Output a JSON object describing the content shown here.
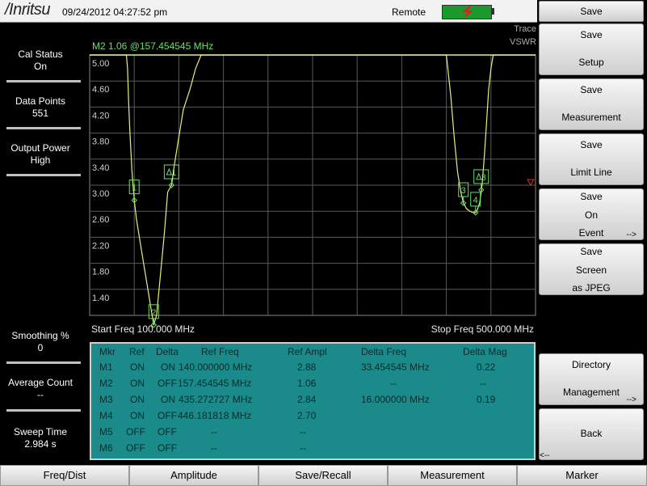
{
  "header": {
    "logo": "/Inritsu",
    "datetime": "09/24/2012 04:27:52 pm",
    "remote_label": "Remote"
  },
  "chart_header": {
    "marker_readout": "M2 1.06 @157.454545 MHz",
    "trace_label": "Trace",
    "trace_mode": "VSWR"
  },
  "left_panel": [
    {
      "label": "Cal Status",
      "value": "On"
    },
    {
      "label": "Data Points",
      "value": "551"
    },
    {
      "label": "Output Power",
      "value": "High"
    },
    {
      "label": "Smoothing %",
      "value": "0"
    },
    {
      "label": "Average Count",
      "value": "--"
    },
    {
      "label": "Sweep Time",
      "value": "2.984 s"
    }
  ],
  "softkeys": {
    "title": "Save",
    "save_setup": [
      "Save",
      "Setup"
    ],
    "save_measurement": [
      "Save",
      "Measurement"
    ],
    "save_limit_line": [
      "Save",
      "Limit Line"
    ],
    "save_on_event": [
      "Save",
      "On",
      "Event"
    ],
    "save_screen_jpeg": [
      "Save",
      "Screen",
      "as JPEG"
    ],
    "directory_management": [
      "Directory",
      "Management"
    ],
    "back": "Back",
    "more_arrow": "-->",
    "back_arrow": "<--"
  },
  "bottom_tabs": [
    "Freq/Dist",
    "Amplitude",
    "Save/Recall",
    "Measurement",
    "Marker"
  ],
  "freq_labels": {
    "start": "Start Freq 100.000 MHz",
    "stop": "Stop Freq 500.000 MHz"
  },
  "marker_table": {
    "headers": [
      "Mkr",
      "Ref",
      "Delta",
      "Ref Freq",
      "Ref Ampl",
      "Delta Freq",
      "Delta Mag"
    ],
    "rows": [
      [
        "M1",
        "ON",
        "ON",
        "140.000000 MHz",
        "2.88",
        "33.454545 MHz",
        "0.22"
      ],
      [
        "M2",
        "ON",
        "OFF",
        "157.454545 MHz",
        "1.06",
        "--",
        "--"
      ],
      [
        "M3",
        "ON",
        "ON",
        "435.272727 MHz",
        "2.84",
        "16.000000 MHz",
        "0.19"
      ],
      [
        "M4",
        "ON",
        "OFF",
        "446.181818 MHz",
        "2.70",
        "",
        ""
      ],
      [
        "M5",
        "OFF",
        "OFF",
        "--",
        "--",
        "",
        ""
      ],
      [
        "M6",
        "OFF",
        "OFF",
        "--",
        "--",
        "",
        ""
      ]
    ]
  },
  "chart_data": {
    "type": "line",
    "xlim": [
      100,
      500
    ],
    "ylim": [
      1.2,
      5.0
    ],
    "yticks": [
      "5.00",
      "4.60",
      "4.20",
      "3.80",
      "3.40",
      "3.00",
      "2.60",
      "2.20",
      "1.80",
      "1.40"
    ],
    "series": [
      {
        "x": [
          100,
          133,
          134,
          135,
          136,
          138,
          140,
          142,
          145,
          148,
          152,
          155,
          157.45,
          160,
          163,
          167,
          170,
          173.45,
          176,
          180,
          184,
          190,
          195,
          200,
          300,
          400,
          420,
          424,
          427,
          430,
          433,
          435.27,
          438,
          441,
          444,
          446.18,
          448,
          450,
          452,
          454,
          456,
          458,
          460,
          462,
          470,
          500
        ],
        "y": [
          5.0,
          5.0,
          4.8,
          4.3,
          3.9,
          3.3,
          2.88,
          2.6,
          2.3,
          2.0,
          1.6,
          1.3,
          1.06,
          1.2,
          1.7,
          2.4,
          3.0,
          3.1,
          3.4,
          3.8,
          4.2,
          4.5,
          4.8,
          5.0,
          5.0,
          5.0,
          5.0,
          4.4,
          3.8,
          3.3,
          3.0,
          2.84,
          2.76,
          2.72,
          2.7,
          2.7,
          2.75,
          2.85,
          3.1,
          3.5,
          4.0,
          4.5,
          4.8,
          5.0,
          5.0,
          5.0
        ],
        "color": "#e8f07a"
      }
    ],
    "limit_line": {
      "y": 5.0,
      "color": "#e8f07a"
    },
    "markers": [
      {
        "label": "1",
        "x": 140,
        "y": 2.88,
        "delta": false
      },
      {
        "label": "2",
        "x": 157.45,
        "y": 1.06,
        "delta": false
      },
      {
        "label": "1",
        "x": 173.45,
        "y": 3.1,
        "delta": true
      },
      {
        "label": "3",
        "x": 435.27,
        "y": 2.84,
        "delta": false
      },
      {
        "label": "4",
        "x": 446.18,
        "y": 2.7,
        "delta": false
      },
      {
        "label": "3",
        "x": 451.27,
        "y": 3.03,
        "delta": true
      }
    ]
  }
}
